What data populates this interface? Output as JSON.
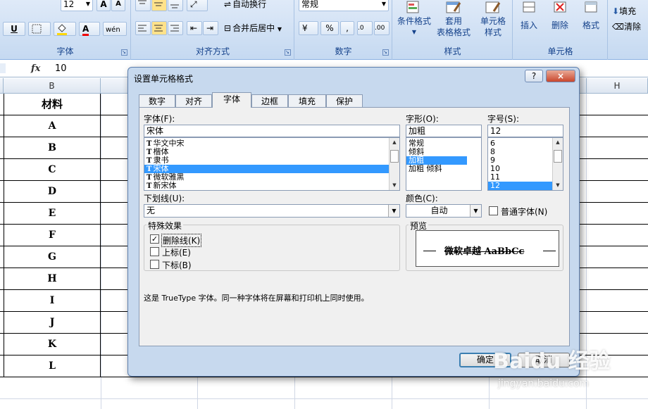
{
  "ribbon": {
    "font_group": {
      "label": "字体",
      "size_value": "12",
      "underline_label": "U"
    },
    "align_group": {
      "label": "对齐方式",
      "wrap_label": "自动换行",
      "merge_label": "合并后居中"
    },
    "number_group": {
      "label": "数字",
      "format_value": "常规",
      "percent": "%",
      "comma": ","
    },
    "styles_group": {
      "label": "样式",
      "cond_format_l1": "条件格式",
      "table_format_l1": "套用",
      "table_format_l2": "表格格式",
      "cell_style_l1": "单元格",
      "cell_style_l2": "样式"
    },
    "cells_group": {
      "label": "单元格",
      "insert": "插入",
      "delete": "删除",
      "format": "格式"
    },
    "edit_group": {
      "fill": "填充",
      "clear": "清除"
    }
  },
  "formula_bar": {
    "fx": "fx",
    "value": "10"
  },
  "sheet": {
    "column_b_header": "B",
    "column_h_header": "H",
    "rows": [
      "材料",
      "A",
      "B",
      "C",
      "D",
      "E",
      "F",
      "G",
      "H",
      "I",
      "J",
      "K",
      "L"
    ]
  },
  "dialog": {
    "title": "设置单元格格式",
    "help_button": "?",
    "close_button": "×",
    "tabs": [
      "数字",
      "对齐",
      "字体",
      "边框",
      "填充",
      "保护"
    ],
    "active_tab": "字体",
    "font_label": "字体(F):",
    "font_value": "宋体",
    "font_list": [
      "华文中宋",
      "楷体",
      "隶书",
      "宋体",
      "微软雅黑",
      "新宋体"
    ],
    "font_selected": "宋体",
    "style_label": "字形(O):",
    "style_value": "加粗",
    "style_list": [
      "常规",
      "倾斜",
      "加粗",
      "加粗 倾斜"
    ],
    "style_selected": "加粗",
    "size_label": "字号(S):",
    "size_value": "12",
    "size_list": [
      "6",
      "8",
      "9",
      "10",
      "11",
      "12"
    ],
    "size_selected": "12",
    "underline_label": "下划线(U):",
    "underline_value": "无",
    "color_label": "颜色(C):",
    "color_value": "自动",
    "normal_font_label": "普通字体(N)",
    "effects_label": "特殊效果",
    "strikethrough_label": "删除线(K)",
    "superscript_label": "上标(E)",
    "subscript_label": "下标(B)",
    "preview_label": "预览",
    "preview_text": "微软卓越  AaBbCc",
    "info_text": "这是 TrueType 字体。同一种字体将在屏幕和打印机上同时使用。",
    "ok_button": "确定",
    "cancel_button": "取消"
  },
  "watermark": {
    "line1": "Baidu 经验",
    "line2": "jingyan.baidu.com"
  }
}
